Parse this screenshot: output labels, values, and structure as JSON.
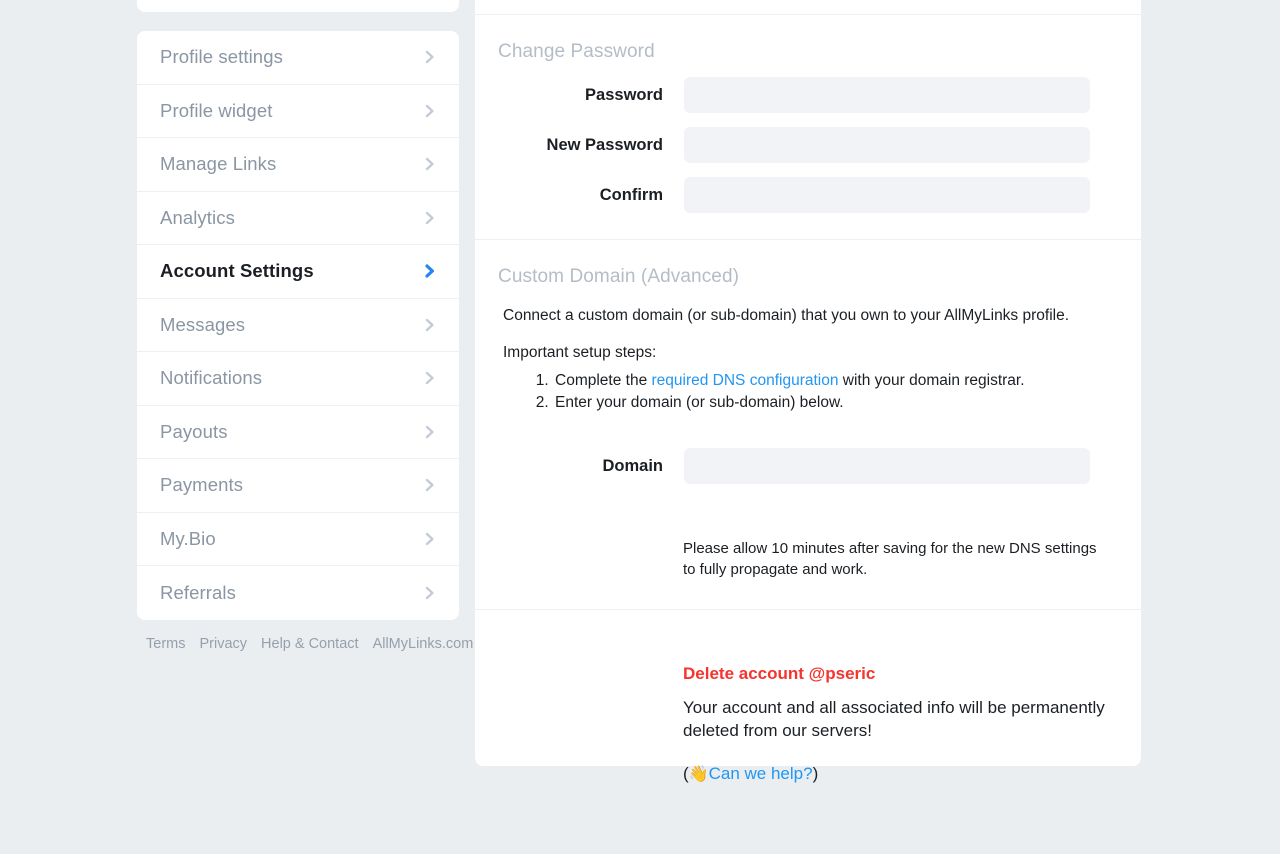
{
  "colors": {
    "background": "#eaeef1",
    "card": "#ffffff",
    "muted_text": "#8a96a3",
    "heading_muted": "#b4bdc6",
    "link_blue": "#2196f3",
    "accent_blue": "#2684f5",
    "danger_red": "#f5342e",
    "field_bg": "#f2f3f6",
    "divider": "#edf0f3"
  },
  "sidebar": {
    "items": [
      {
        "label": "Profile settings",
        "active": false,
        "icon": "chevron-right-icon"
      },
      {
        "label": "Profile widget",
        "active": false,
        "icon": "chevron-right-icon"
      },
      {
        "label": "Manage Links",
        "active": false,
        "icon": "chevron-right-icon"
      },
      {
        "label": "Analytics",
        "active": false,
        "icon": "chevron-right-icon"
      },
      {
        "label": "Account Settings",
        "active": true,
        "icon": "chevron-right-icon"
      },
      {
        "label": "Messages",
        "active": false,
        "icon": "chevron-right-icon"
      },
      {
        "label": "Notifications",
        "active": false,
        "icon": "chevron-right-icon"
      },
      {
        "label": "Payouts",
        "active": false,
        "icon": "chevron-right-icon"
      },
      {
        "label": "Payments",
        "active": false,
        "icon": "chevron-right-icon"
      },
      {
        "label": "My.Bio",
        "active": false,
        "icon": "chevron-right-icon"
      },
      {
        "label": "Referrals",
        "active": false,
        "icon": "chevron-right-icon"
      }
    ]
  },
  "footer": {
    "links": [
      {
        "label": "Terms"
      },
      {
        "label": "Privacy"
      },
      {
        "label": "Help & Contact"
      },
      {
        "label": "AllMyLinks.com"
      }
    ]
  },
  "change_password": {
    "title": "Change Password",
    "fields": [
      {
        "label": "Password",
        "value": "",
        "placeholder": ""
      },
      {
        "label": "New Password",
        "value": "",
        "placeholder": ""
      },
      {
        "label": "Confirm",
        "value": "",
        "placeholder": ""
      }
    ]
  },
  "custom_domain": {
    "title": "Custom Domain (Advanced)",
    "intro": "Connect a custom domain (or sub-domain) that you own to your AllMyLinks profile.",
    "steps_heading": "Important setup steps:",
    "step1_before": "Complete the ",
    "step1_link": "required DNS configuration",
    "step1_after": " with your domain registrar.",
    "step2": "Enter your domain (or sub-domain) below.",
    "domain_label": "Domain",
    "domain_value": "",
    "domain_placeholder": "",
    "note": "Please allow 10 minutes after saving for the new DNS settings to fully propagate and work."
  },
  "delete_account": {
    "title": "Delete account @pseric",
    "body": "Your account and all associated info will be permanently deleted from our servers!",
    "help_open": "(",
    "help_wave": "👋",
    "help_link": "Can we help?",
    "help_close": ")"
  }
}
